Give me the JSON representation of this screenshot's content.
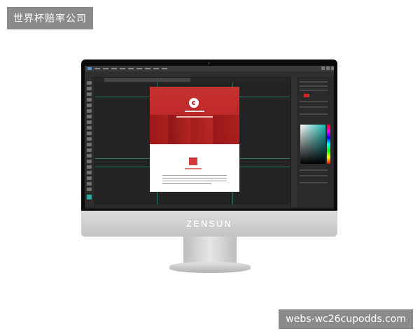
{
  "watermark_top": "世界杯赔率公司",
  "watermark_bottom": "webs-wc26cupodds.com",
  "monitor": {
    "brand": "ZENSUN"
  },
  "photoshop": {
    "accent_colors": {
      "artboard_hero": "#c02626",
      "guide": "#2d6f6a",
      "picker_hue": "#18b7b0"
    }
  },
  "icons": [
    "camera-dot",
    "window-controls",
    "tool-icons",
    "color-picker"
  ]
}
